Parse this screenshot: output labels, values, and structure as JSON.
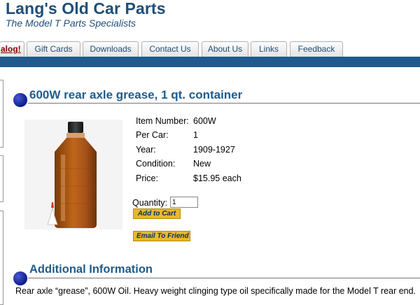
{
  "header": {
    "title": "Lang's Old Car Parts",
    "tagline": "The Model T Parts Specialists"
  },
  "nav": {
    "tabs": [
      {
        "label": "alog!"
      },
      {
        "label": "Gift Cards"
      },
      {
        "label": "Downloads"
      },
      {
        "label": "Contact Us"
      },
      {
        "label": "About Us"
      },
      {
        "label": "Links"
      },
      {
        "label": "Feedback"
      }
    ]
  },
  "product": {
    "title": "600W rear axle grease, 1 qt. container",
    "specs": [
      {
        "label": "Item Number:",
        "value": "600W"
      },
      {
        "label": "Per Car:",
        "value": "1"
      },
      {
        "label": "Year:",
        "value": "1909-1927"
      },
      {
        "label": "Condition:",
        "value": "New"
      },
      {
        "label": "Price:",
        "value": "$15.95 each"
      }
    ],
    "quantity_label": "Quantity:",
    "quantity_value": "1",
    "add_to_cart_label": "Add to Cart",
    "email_friend_label": "Email To Friend"
  },
  "additional": {
    "title": "Additional Information",
    "description": "Rear axle “grease”, 600W Oil. Heavy weight clinging type oil specifically made for the Model T rear end."
  },
  "colors": {
    "brand_blue": "#1f4e79",
    "nav_bar": "#205a8b",
    "button_gold": "#e8b82a"
  }
}
